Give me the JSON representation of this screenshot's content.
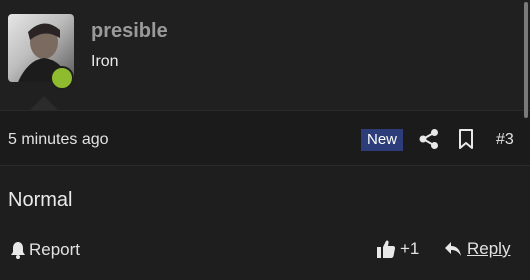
{
  "author": {
    "username": "presible",
    "title": "Iron",
    "online": true
  },
  "meta": {
    "time": "5 minutes ago",
    "badge": "New",
    "post_number": "#3"
  },
  "post": {
    "body": "Normal"
  },
  "actions": {
    "report_label": "Report",
    "like_count": "+1",
    "reply_label": "Reply"
  },
  "icons": {
    "share": "share-icon",
    "bookmark": "bookmark-icon",
    "bell": "bell-icon",
    "thumbs_up": "thumbs-up-icon",
    "reply": "reply-arrow-icon"
  },
  "colors": {
    "online": "#8fbc2f",
    "badge_bg": "#2c3d7a",
    "username": "#9a9a9a"
  }
}
